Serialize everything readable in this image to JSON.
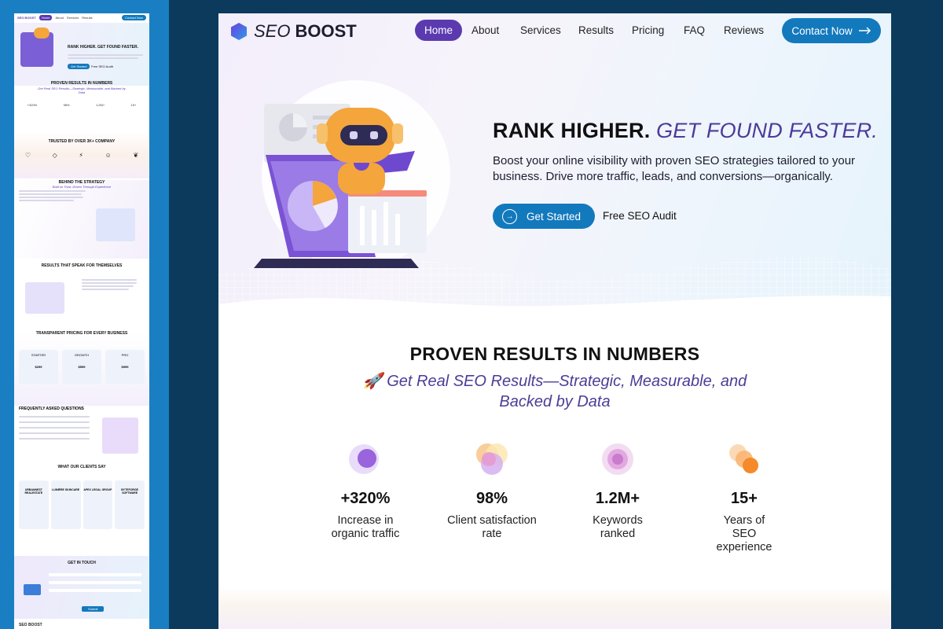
{
  "brand": {
    "part1": "SEO",
    "part2": "BOOST"
  },
  "nav": {
    "items": [
      {
        "label": "Home"
      },
      {
        "label": "About"
      },
      {
        "label": "Services"
      },
      {
        "label": "Results"
      },
      {
        "label": "Pricing"
      },
      {
        "label": "FAQ"
      },
      {
        "label": "Reviews"
      }
    ],
    "contact_label": "Contact Now"
  },
  "hero": {
    "title_strong": "RANK HIGHER.",
    "title_accent": "GET FOUND FASTER.",
    "description": "Boost your online visibility with proven SEO strategies tailored to your business. Drive more traffic, leads, and conversions—organically.",
    "primary_cta": "Get Started",
    "secondary_cta": "Free SEO Audit"
  },
  "stats": {
    "title": "PROVEN RESULTS IN NUMBERS",
    "subtitle": "🚀 Get Real SEO Results—Strategic, Measurable, and Backed by Data",
    "items": [
      {
        "value": "+320%",
        "label": "Increase in organic traffic",
        "icon": "purple-circles-icon"
      },
      {
        "value": "98%",
        "label": "Client satisfaction rate",
        "icon": "overlap-circles-icon"
      },
      {
        "value": "1.2M+",
        "label": "Keywords ranked",
        "icon": "target-circles-icon"
      },
      {
        "value": "15+",
        "label": "Years of SEO experience",
        "icon": "orange-circles-icon"
      }
    ]
  },
  "preview": {
    "nav_brand": "SEO BOOST",
    "nav_items": [
      "Home",
      "About",
      "Services",
      "Results",
      "Pricing",
      "FAQ",
      "Reviews"
    ],
    "nav_cta": "Contact Now",
    "hero_title": "RANK HIGHER. GET FOUND FASTER.",
    "hero_cta": "Get Started",
    "hero_secondary": "Free SEO Audit",
    "stats_title": "PROVEN RESULTS IN NUMBERS",
    "stats_subtitle": "Get Real SEO Results—Strategic, Measurable, and Backed by Data",
    "stat_values": [
      "+320%",
      "98%",
      "1.2M+",
      "15+"
    ],
    "trusted_title": "TRUSTED BY OVER 3K+ COMPANY",
    "strategy_title": "BEHIND THE STRATEGY",
    "strategy_sub": "Built on Trust. Driven Through Experience",
    "results_title": "RESULTS THAT SPEAK FOR THEMSELVES",
    "pricing_title": "TRANSPARENT PRICING FOR EVERY BUSINESS",
    "plans": [
      {
        "name": "STARTER",
        "price": "$299"
      },
      {
        "name": "GROWTH",
        "price": "$599"
      },
      {
        "name": "PRO",
        "price": "$999"
      }
    ],
    "faq_title": "FREQUENTLY ASKED QUESTIONS",
    "clients_title": "WHAT OUR CLIENTS SAY",
    "clients": [
      "URBANNEST REALESTATE",
      "LUMIÈRE SKINCARE",
      "APEX LEGAL GROUP",
      "BYTEFORGE SOFTWARE"
    ],
    "contact_title": "GET IN TOUCH",
    "contact_submit": "Submit",
    "footer_brand": "SEO BOOST"
  }
}
